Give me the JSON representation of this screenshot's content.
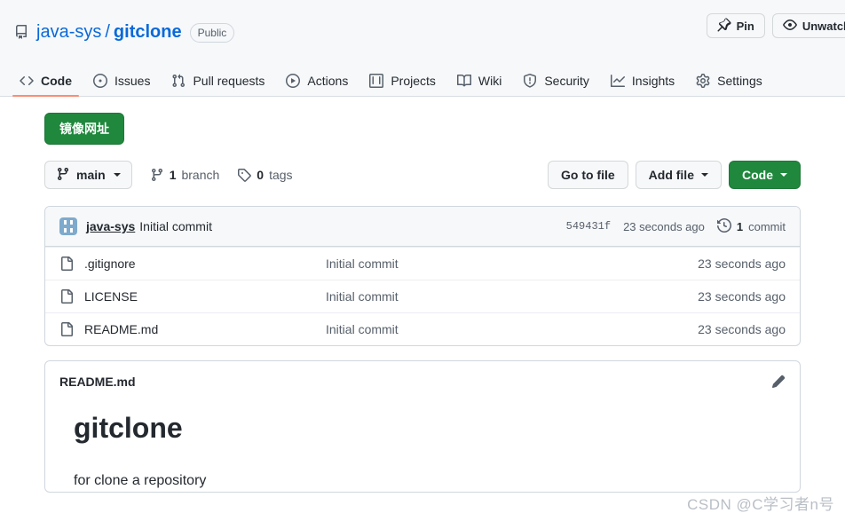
{
  "repo": {
    "owner": "java-sys",
    "separator": "/",
    "name": "gitclone",
    "visibility": "Public"
  },
  "header_actions": [
    {
      "label": "Pin",
      "icon": "pin-icon"
    },
    {
      "label": "Unwatch",
      "icon": "eye-icon"
    }
  ],
  "nav": {
    "items": [
      {
        "label": "Code",
        "icon": "code-icon",
        "selected": true
      },
      {
        "label": "Issues",
        "icon": "issue-opened-icon",
        "selected": false
      },
      {
        "label": "Pull requests",
        "icon": "git-pull-request-icon",
        "selected": false
      },
      {
        "label": "Actions",
        "icon": "play-icon",
        "selected": false
      },
      {
        "label": "Projects",
        "icon": "table-icon",
        "selected": false
      },
      {
        "label": "Wiki",
        "icon": "book-icon",
        "selected": false
      },
      {
        "label": "Security",
        "icon": "shield-icon",
        "selected": false
      },
      {
        "label": "Insights",
        "icon": "graph-icon",
        "selected": false
      },
      {
        "label": "Settings",
        "icon": "gear-icon",
        "selected": false
      }
    ]
  },
  "mirror_button": {
    "label": "镜像网址"
  },
  "toolbar": {
    "branch": "main",
    "branch_count": "1",
    "branch_label": "branch",
    "tag_count": "0",
    "tag_label": "tags",
    "go_to_file": "Go to file",
    "add_file": "Add file",
    "code": "Code"
  },
  "commit_bar": {
    "author": "java-sys",
    "message": "Initial commit",
    "sha": "549431f",
    "time": "23 seconds ago",
    "commit_count": "1",
    "commit_word": "commit"
  },
  "files": [
    {
      "name": ".gitignore",
      "message": "Initial commit",
      "time": "23 seconds ago"
    },
    {
      "name": "LICENSE",
      "message": "Initial commit",
      "time": "23 seconds ago"
    },
    {
      "name": "README.md",
      "message": "Initial commit",
      "time": "23 seconds ago"
    }
  ],
  "readme": {
    "title": "README.md",
    "heading": "gitclone",
    "paragraph": "for clone a repository"
  },
  "watermark": "CSDN @C学习者n号",
  "colors": {
    "accent": "#0969da",
    "green": "#1f883d",
    "active_tab_underline": "#fd8c73",
    "header_bg": "#f6f8fa",
    "border": "#d0d7de",
    "muted_text": "#57606a"
  }
}
